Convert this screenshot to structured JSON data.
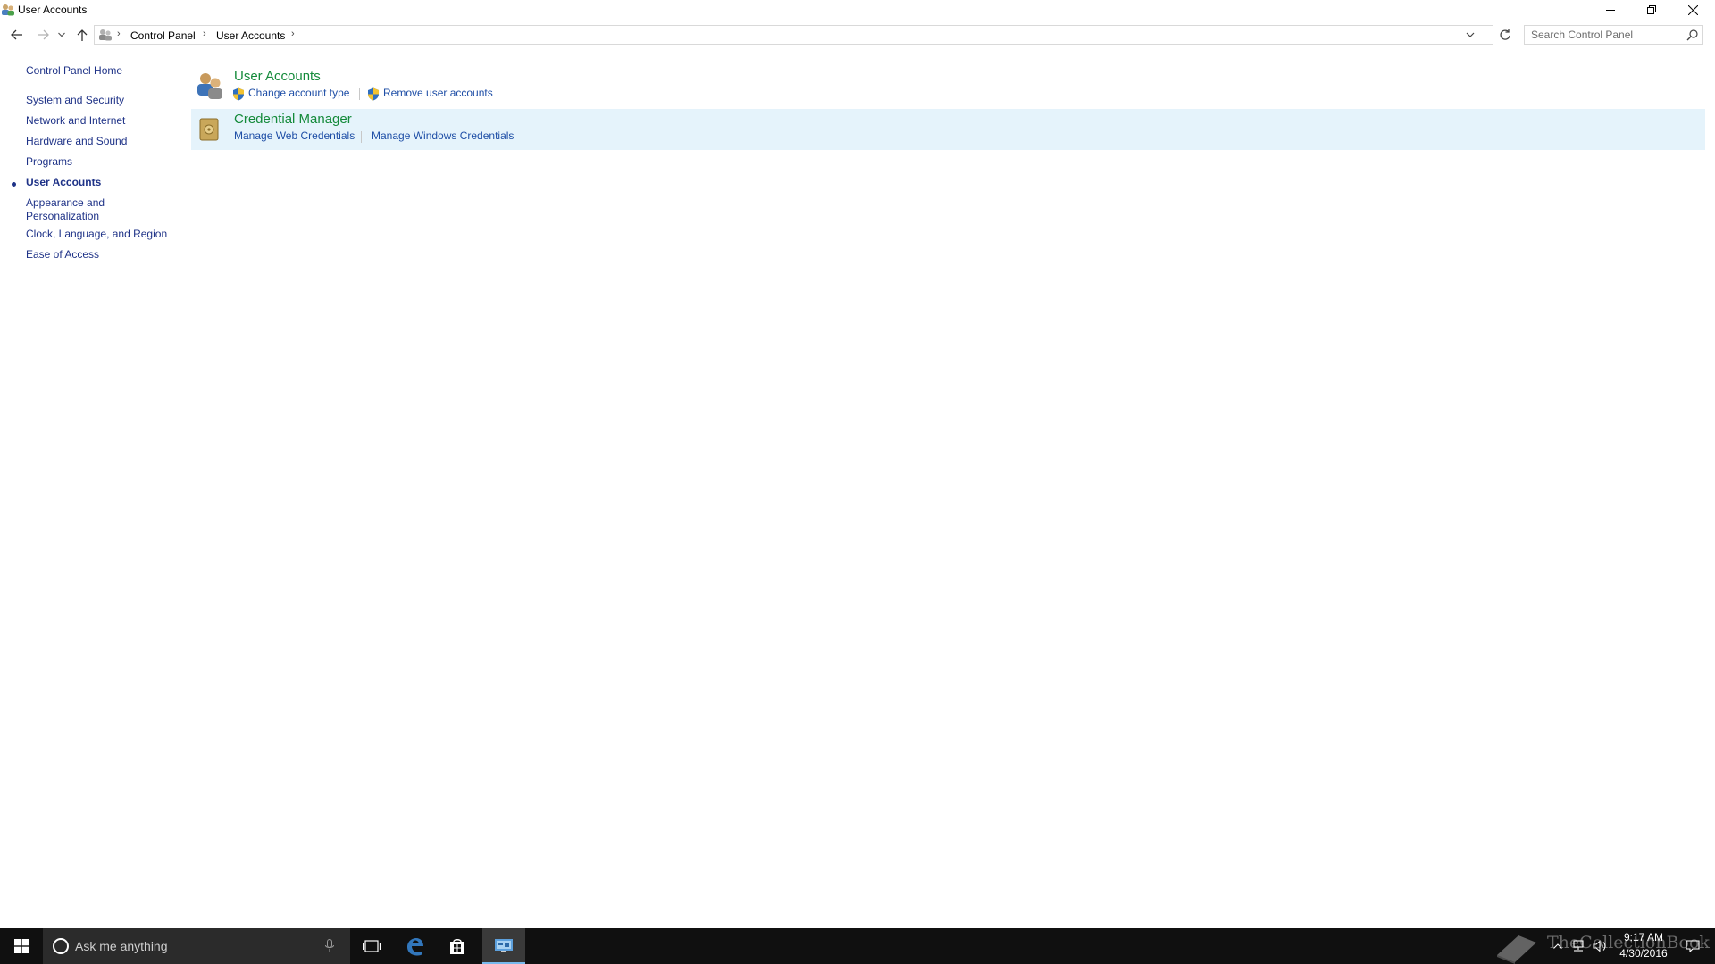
{
  "window": {
    "title": "User Accounts"
  },
  "address": {
    "crumbs": [
      "Control Panel",
      "User Accounts"
    ],
    "search_placeholder": "Search Control Panel"
  },
  "leftnav": {
    "home": "Control Panel Home",
    "categories": [
      {
        "label": "System and Security",
        "active": false
      },
      {
        "label": "Network and Internet",
        "active": false
      },
      {
        "label": "Hardware and Sound",
        "active": false
      },
      {
        "label": "Programs",
        "active": false
      },
      {
        "label": "User Accounts",
        "active": true
      },
      {
        "label": "Appearance and",
        "label2": "Personalization",
        "active": false
      },
      {
        "label": "Clock, Language, and Region",
        "active": false
      },
      {
        "label": "Ease of Access",
        "active": false
      }
    ]
  },
  "main": {
    "sections": [
      {
        "title": "User Accounts",
        "icon": "users-icon",
        "links": [
          "Change account type",
          "Remove user accounts"
        ]
      },
      {
        "title": "Credential Manager",
        "icon": "credential-vault-icon",
        "links": [
          "Manage Web Credentials",
          "Manage Windows Credentials"
        ]
      }
    ]
  },
  "taskbar": {
    "search_text": "Ask me anything",
    "time": "9:17 AM",
    "date": "4/30/2016",
    "watermark": "TheCollectionBook"
  },
  "colors": {
    "link": "#1e4ea6",
    "category_title": "#148a3a",
    "nav_link": "#1e3287",
    "hover_row": "#e5f3fb",
    "taskbar": "#101010"
  }
}
